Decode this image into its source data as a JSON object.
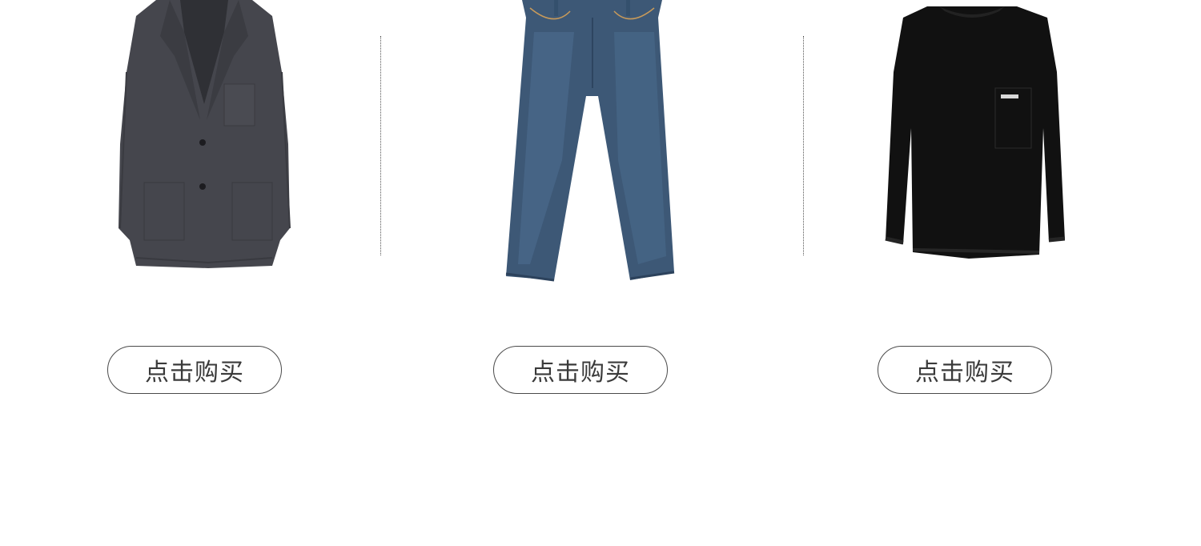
{
  "products": [
    {
      "name": "blazer-image",
      "button_label": "点击购买",
      "color": "#45464d"
    },
    {
      "name": "jeans-image",
      "button_label": "点击购买",
      "color": "#3d5876"
    },
    {
      "name": "sweater-image",
      "button_label": "点击购买",
      "color": "#111111"
    }
  ],
  "colors": {
    "background": "#ffffff",
    "button_border": "#4a4a4a",
    "button_text": "#3a3a3a",
    "divider": "#555555"
  }
}
